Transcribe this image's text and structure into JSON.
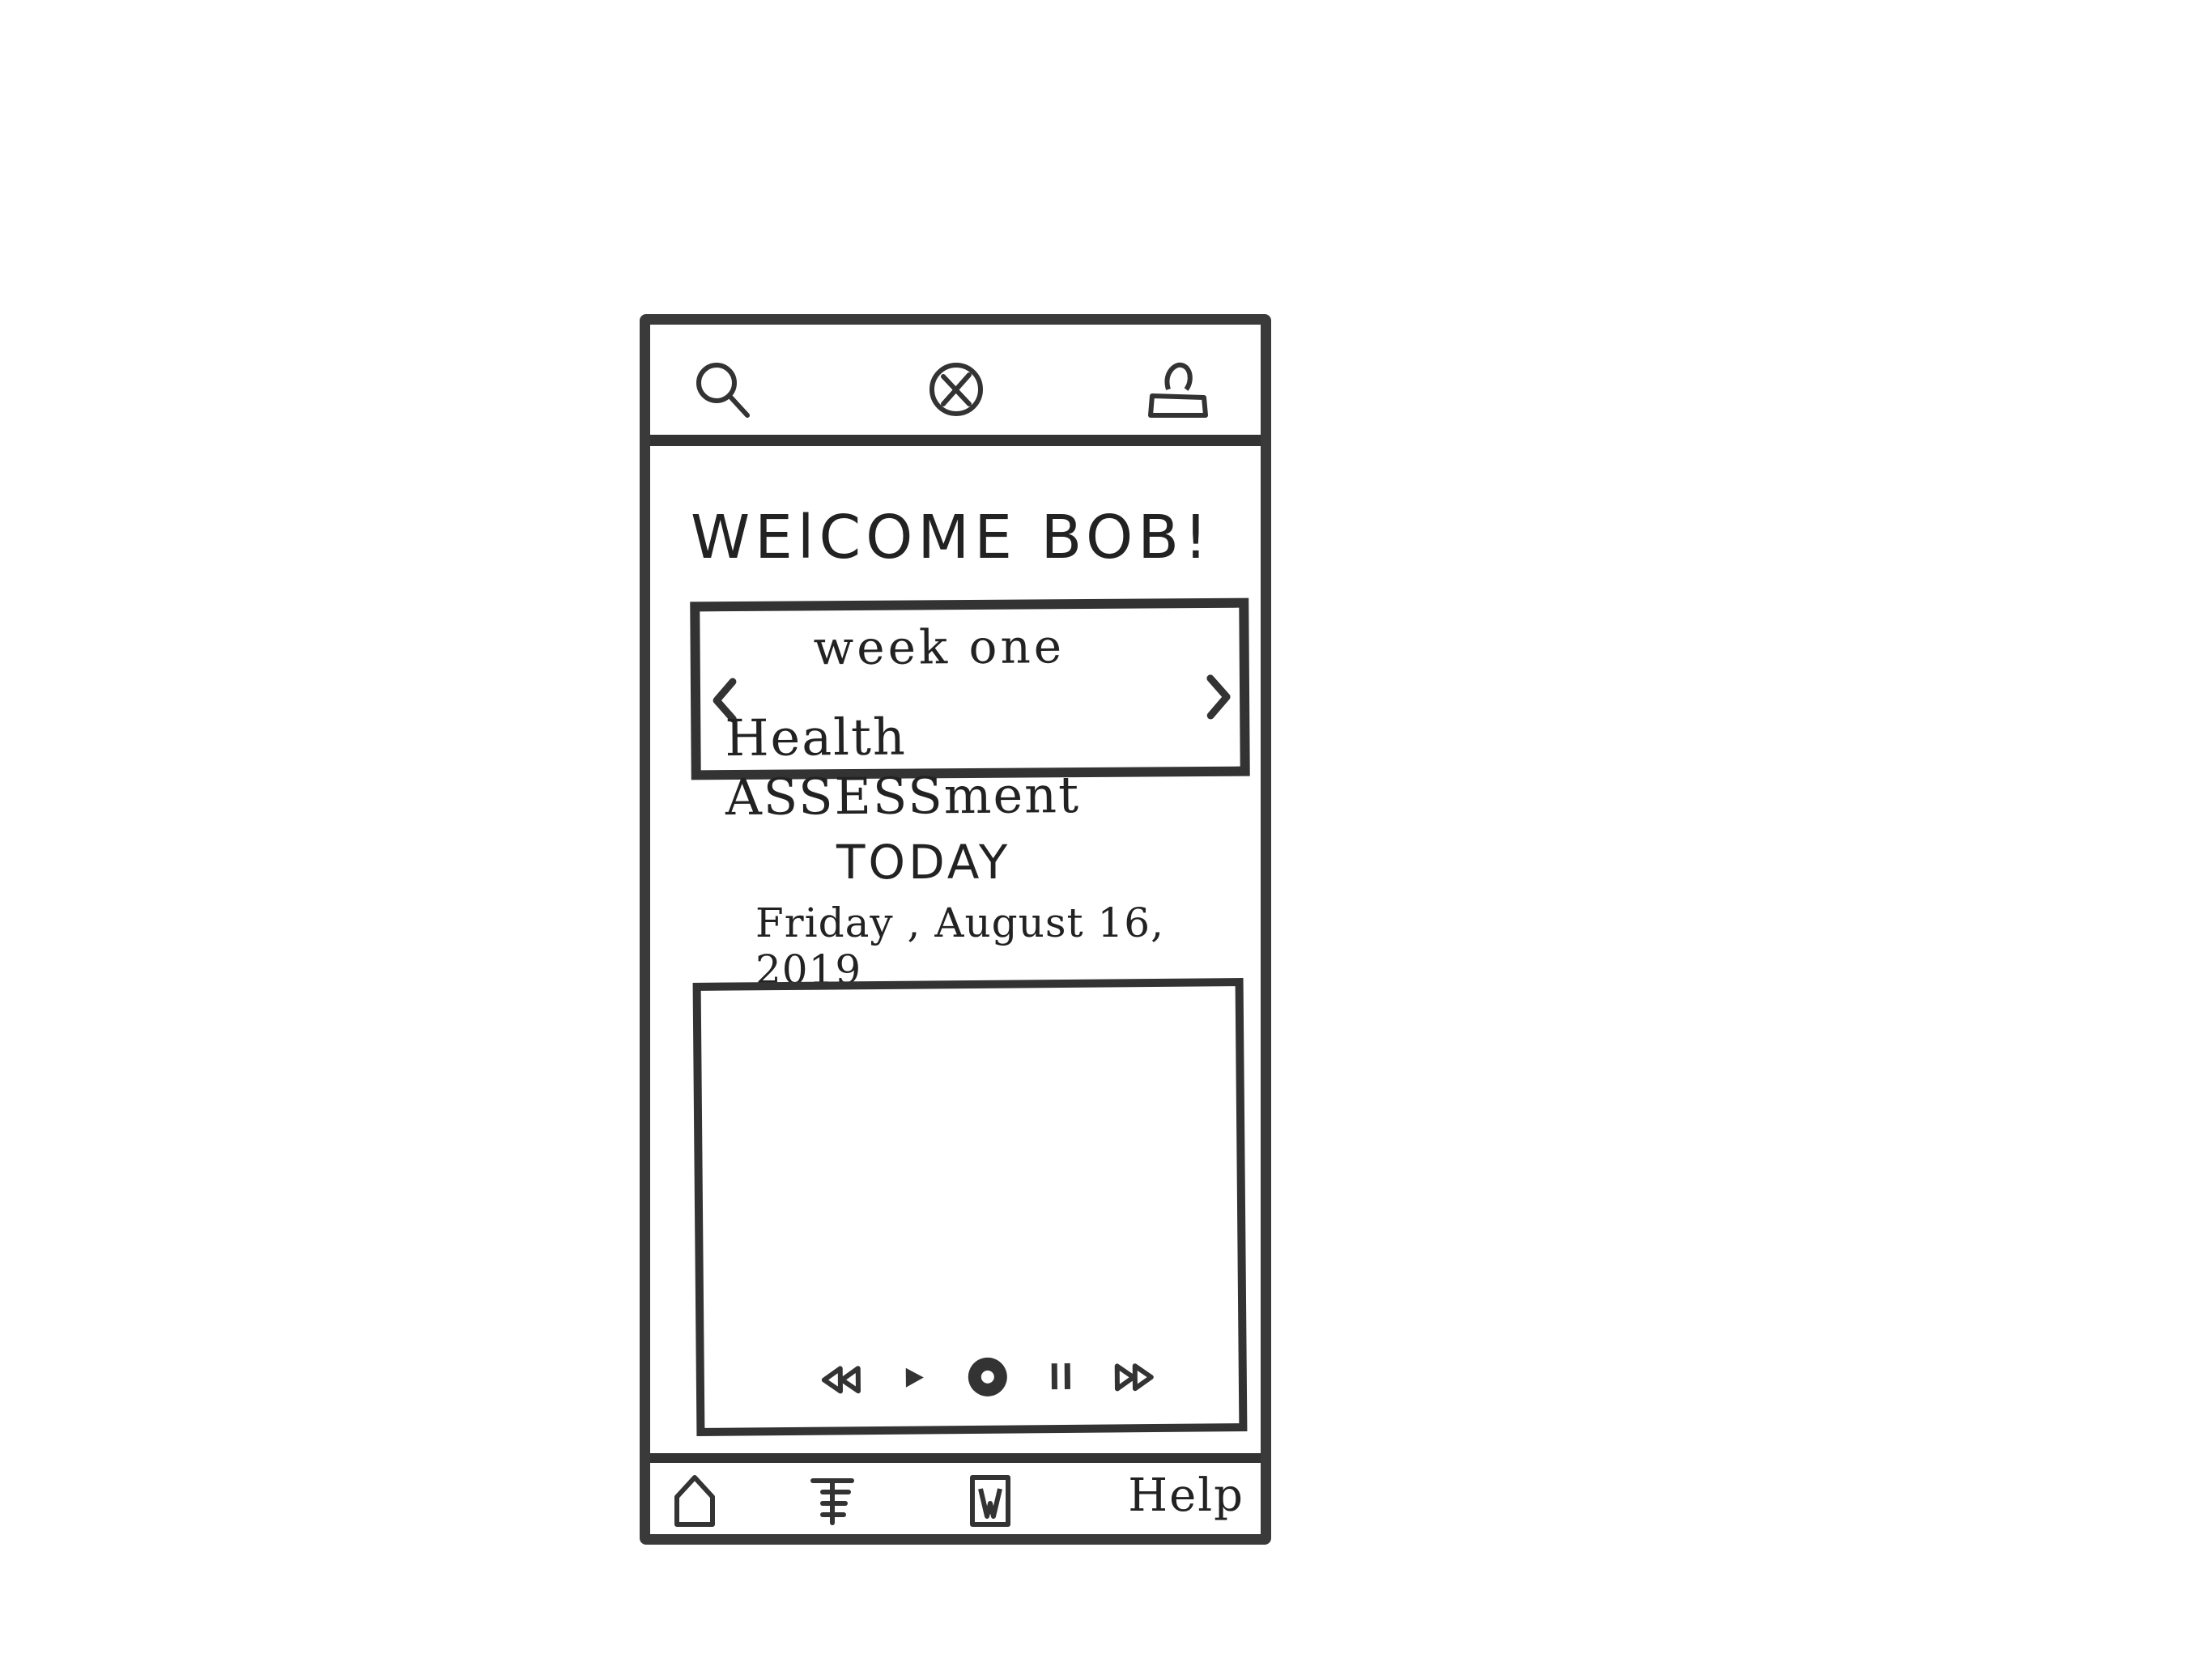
{
  "top_bar": {
    "icons": [
      "search-icon",
      "close-circle-icon",
      "profile-icon"
    ]
  },
  "welcome": {
    "text": "WElCOME BOB!"
  },
  "week_card": {
    "title": "week one",
    "subtitle": "Health ASSESSment"
  },
  "today": {
    "label": "TODAY",
    "date": "Friday , August 16, 2019"
  },
  "video_controls": [
    "rewind-icon",
    "play-icon",
    "record-icon",
    "pause-icon",
    "fast-forward-icon"
  ],
  "bottom_nav": {
    "icons": [
      "home-icon",
      "list-icon",
      "bookmark-icon"
    ],
    "help_label": "Help"
  },
  "colors": {
    "stroke": "#333333",
    "background": "#ffffff"
  }
}
